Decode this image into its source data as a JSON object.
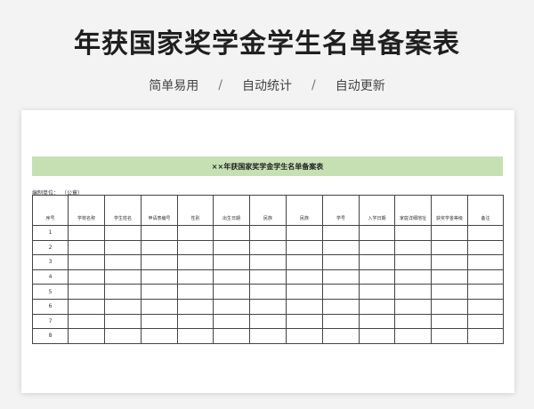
{
  "header": {
    "title": "年获国家奖学金学生名单备案表",
    "tagline": [
      "简单易用",
      "自动统计",
      "自动更新"
    ],
    "separator": "/"
  },
  "sheet": {
    "banner_title": "××年获国家奖学金学生名单备案表",
    "unit_label": "编制单位：",
    "unit_seal": "（公章）",
    "banner_color": "#c6e0b4",
    "columns": [
      "序号",
      "学校名称",
      "学生姓名",
      "申请表编号",
      "性别",
      "出生日期",
      "民族",
      "民族",
      "学号",
      "入学日期",
      "家庭详细地址",
      "获奖学金等级",
      "备注"
    ],
    "row_numbers": [
      "1",
      "2",
      "3",
      "4",
      "5",
      "6",
      "7",
      "8"
    ]
  }
}
